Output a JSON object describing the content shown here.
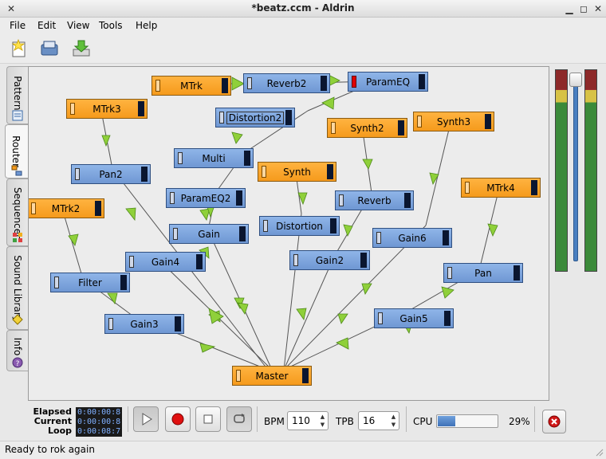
{
  "window": {
    "title": "*beatz.ccm - Aldrin"
  },
  "menu": {
    "items": [
      "File",
      "Edit",
      "View",
      "Tools",
      "Help"
    ]
  },
  "side_tabs": [
    "Patterns",
    "Router",
    "Sequencer",
    "Sound Library",
    "Info"
  ],
  "active_tab": "Router",
  "machines": {
    "mtrk": "MTrk",
    "reverb2": "Reverb2",
    "parameq": "ParamEQ",
    "mtrk3": "MTrk3",
    "distortion2": "Distortion2",
    "synth2": "Synth2",
    "synth3": "Synth3",
    "multi": "Multi",
    "synth": "Synth",
    "pan2": "Pan2",
    "reverb": "Reverb",
    "mtrk4": "MTrk4",
    "parameq2": "ParamEQ2",
    "mtrk2": "MTrk2",
    "gain": "Gain",
    "distortion": "Distortion",
    "gain6": "Gain6",
    "gain4": "Gain4",
    "gain2": "Gain2",
    "pan": "Pan",
    "filter": "Filter",
    "gain3": "Gain3",
    "gain5": "Gain5",
    "master": "Master"
  },
  "transport": {
    "elapsed_label": "Elapsed",
    "current_label": "Current",
    "loop_label": "Loop",
    "elapsed": "0:00:00:8",
    "current": "0:00:00:8",
    "loop": "0:00:08:7"
  },
  "bpm": {
    "label": "BPM",
    "value": "110"
  },
  "tpb": {
    "label": "TPB",
    "value": "16"
  },
  "cpu": {
    "label": "CPU",
    "value": "29%",
    "fraction": 0.29
  },
  "status": "Ready to rok again",
  "colors": {
    "generator": "#f59a1c",
    "effect": "#6f97d3",
    "wire_arrow": "#8fd03a",
    "accent": "#4a7fc0"
  }
}
